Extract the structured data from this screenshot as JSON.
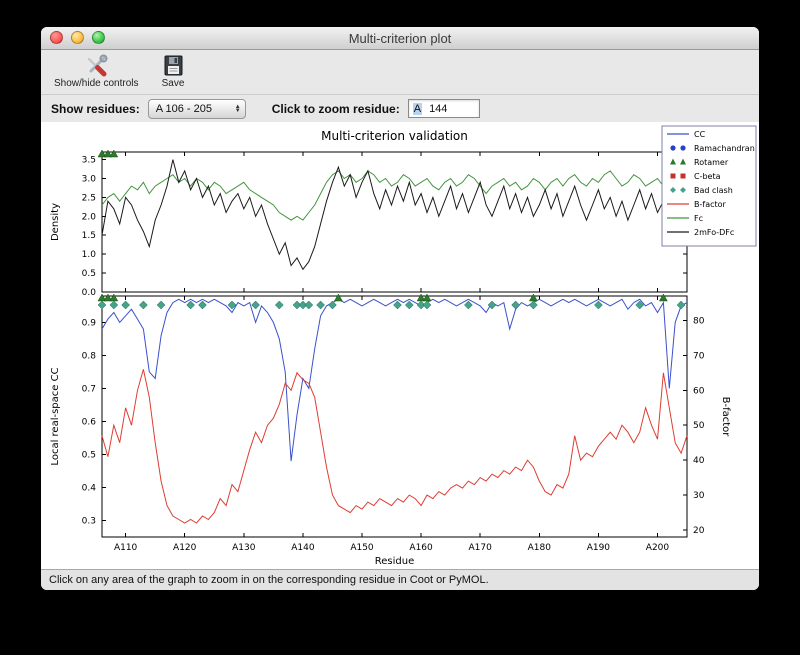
{
  "window": {
    "title": "Multi-criterion plot"
  },
  "toolbar": {
    "show_hide": "Show/hide controls",
    "save": "Save"
  },
  "controls": {
    "show_residues_label": "Show residues:",
    "residue_range": "A 106 - 205",
    "zoom_label": "Click to zoom residue:",
    "zoom_chain": "A",
    "zoom_number": "144"
  },
  "status": "Click on any area of the graph to zoom in on the corresponding residue in Coot or PyMOL.",
  "chart_data": {
    "type": "line",
    "title": "Multi-criterion validation",
    "xlabel": "Residue",
    "x_range": [
      106,
      205
    ],
    "x_ticks": [
      "A110",
      "A120",
      "A130",
      "A140",
      "A150",
      "A160",
      "A170",
      "A180",
      "A190",
      "A200"
    ],
    "top": {
      "ylabel": "Density",
      "ylim": [
        0.0,
        3.7
      ],
      "yticks": [
        0.0,
        0.5,
        1.0,
        1.5,
        2.0,
        2.5,
        3.0,
        3.5
      ]
    },
    "bottom": {
      "ylabel_left": "Local real-space CC",
      "ylim_left": [
        0.25,
        0.98
      ],
      "yticks_left": [
        0.3,
        0.4,
        0.5,
        0.6,
        0.7,
        0.8,
        0.9
      ],
      "ylabel_right": "B-factor",
      "ylim_right": [
        18,
        87
      ],
      "yticks_right": [
        20,
        30,
        40,
        50,
        60,
        70,
        80
      ]
    },
    "axis_label_colors": {
      "left": "#3b50cc",
      "right": "#dd3d33"
    },
    "legend": [
      {
        "label": "CC",
        "type": "line",
        "color": "#3b50cc"
      },
      {
        "label": "Ramachandran",
        "type": "circles",
        "color": "#2742c8"
      },
      {
        "label": "Rotamer",
        "type": "triangles",
        "color": "#2c7a2c"
      },
      {
        "label": "C-beta",
        "type": "squares",
        "color": "#c43030"
      },
      {
        "label": "Bad clash",
        "type": "diamonds",
        "color": "#46a28b"
      },
      {
        "label": "B-factor",
        "type": "line",
        "color": "#dd3d33"
      },
      {
        "label": "Fc",
        "type": "line",
        "color": "#44953f"
      },
      {
        "label": "2mFo-DFc",
        "type": "line",
        "color": "#1a1a1a"
      }
    ],
    "series": [
      {
        "id": "fc",
        "name": "Fc",
        "axis": "top",
        "color": "#44953f",
        "values": [
          2.3,
          2.5,
          2.6,
          2.4,
          2.6,
          2.8,
          2.7,
          2.9,
          2.6,
          2.8,
          2.9,
          3.0,
          3.1,
          2.9,
          3.0,
          2.8,
          3.0,
          2.9,
          2.7,
          2.9,
          2.8,
          2.6,
          2.7,
          2.8,
          2.9,
          2.7,
          2.6,
          2.5,
          2.4,
          2.3,
          2.1,
          2.0,
          1.9,
          2.0,
          1.9,
          2.1,
          2.3,
          2.6,
          2.9,
          3.1,
          3.2,
          3.0,
          3.1,
          2.9,
          3.0,
          3.2,
          3.1,
          2.9,
          3.0,
          2.8,
          2.9,
          3.1,
          3.0,
          2.8,
          2.9,
          3.0,
          2.8,
          2.7,
          2.9,
          3.0,
          2.8,
          2.9,
          3.1,
          3.0,
          2.8,
          2.6,
          2.8,
          2.9,
          3.0,
          2.8,
          2.9,
          2.7,
          2.8,
          3.0,
          2.9,
          2.7,
          2.9,
          3.0,
          2.8,
          3.0,
          3.1,
          2.9,
          2.8,
          3.0,
          2.9,
          3.1,
          3.2,
          3.0,
          2.8,
          2.9,
          3.1,
          3.0,
          2.8,
          2.9,
          3.0,
          2.8,
          2.6,
          2.9,
          3.1,
          2.8
        ]
      },
      {
        "id": "2mfo-dfc",
        "name": "2mFo-DFc",
        "axis": "top",
        "color": "#1a1a1a",
        "values": [
          1.5,
          2.4,
          2.2,
          1.8,
          2.5,
          2.3,
          1.9,
          1.6,
          1.2,
          1.9,
          2.3,
          2.8,
          3.5,
          2.9,
          3.2,
          2.7,
          3.0,
          2.5,
          2.8,
          2.3,
          2.6,
          2.1,
          2.4,
          2.6,
          2.2,
          2.5,
          2.0,
          2.3,
          1.8,
          1.4,
          1.0,
          1.3,
          0.7,
          0.9,
          0.6,
          0.8,
          1.2,
          1.8,
          2.4,
          2.9,
          3.3,
          2.8,
          3.1,
          2.5,
          2.9,
          3.2,
          2.6,
          2.2,
          2.7,
          2.3,
          2.8,
          2.4,
          2.9,
          2.3,
          2.6,
          2.1,
          2.5,
          2.0,
          2.4,
          2.8,
          2.2,
          2.6,
          2.1,
          2.5,
          2.9,
          2.3,
          2.0,
          2.4,
          2.8,
          2.2,
          2.6,
          2.1,
          2.5,
          2.0,
          2.3,
          2.7,
          2.2,
          2.6,
          2.0,
          2.4,
          2.8,
          2.3,
          1.9,
          2.3,
          2.7,
          2.2,
          2.5,
          2.0,
          2.4,
          1.9,
          2.3,
          2.7,
          2.2,
          2.6,
          2.1,
          2.4,
          1.9,
          2.3,
          2.7,
          2.4
        ]
      },
      {
        "id": "cc",
        "name": "CC",
        "axis": "bottom-left",
        "color": "#3b50cc",
        "values": [
          0.88,
          0.91,
          0.93,
          0.9,
          0.92,
          0.94,
          0.91,
          0.88,
          0.75,
          0.73,
          0.86,
          0.93,
          0.96,
          0.97,
          0.96,
          0.97,
          0.96,
          0.97,
          0.96,
          0.97,
          0.96,
          0.95,
          0.93,
          0.96,
          0.95,
          0.96,
          0.9,
          0.95,
          0.93,
          0.9,
          0.85,
          0.75,
          0.48,
          0.62,
          0.73,
          0.7,
          0.82,
          0.92,
          0.95,
          0.96,
          0.97,
          0.96,
          0.97,
          0.96,
          0.95,
          0.96,
          0.97,
          0.96,
          0.95,
          0.96,
          0.97,
          0.96,
          0.97,
          0.96,
          0.95,
          0.96,
          0.97,
          0.96,
          0.97,
          0.96,
          0.95,
          0.96,
          0.97,
          0.96,
          0.95,
          0.93,
          0.96,
          0.95,
          0.96,
          0.88,
          0.94,
          0.96,
          0.95,
          0.96,
          0.97,
          0.96,
          0.95,
          0.96,
          0.97,
          0.96,
          0.97,
          0.96,
          0.95,
          0.96,
          0.97,
          0.96,
          0.95,
          0.96,
          0.97,
          0.94,
          0.96,
          0.97,
          0.95,
          0.96,
          0.93,
          0.96,
          0.7,
          0.9,
          0.95,
          0.96
        ]
      },
      {
        "id": "b-factor",
        "name": "B-factor",
        "axis": "bottom-right",
        "color": "#dd3d33",
        "values": [
          47,
          41,
          50,
          45,
          55,
          50,
          60,
          66,
          58,
          45,
          34,
          27,
          24,
          23,
          22,
          23,
          22,
          24,
          23,
          25,
          29,
          27,
          33,
          31,
          37,
          43,
          48,
          45,
          50,
          52,
          56,
          62,
          60,
          65,
          63,
          62,
          58,
          48,
          38,
          30,
          27,
          26,
          25,
          27,
          26,
          28,
          27,
          29,
          28,
          27,
          29,
          28,
          30,
          29,
          27,
          30,
          29,
          31,
          30,
          32,
          33,
          32,
          34,
          33,
          35,
          34,
          36,
          35,
          37,
          36,
          38,
          37,
          40,
          38,
          34,
          31,
          30,
          33,
          32,
          36,
          47,
          40,
          42,
          41,
          44,
          46,
          48,
          46,
          50,
          48,
          45,
          48,
          55,
          50,
          46,
          65,
          55,
          45,
          42,
          47
        ]
      }
    ],
    "markers": [
      {
        "name": "Rotamer",
        "shape": "triangle",
        "color": "#2c7a2c",
        "residues": [
          106,
          107,
          108,
          146,
          160,
          161,
          179,
          201
        ],
        "top_edge_residues": [
          106,
          107,
          108
        ]
      },
      {
        "name": "Bad clash",
        "shape": "diamond",
        "color": "#46a28b",
        "residues": [
          106,
          108,
          110,
          113,
          116,
          121,
          123,
          128,
          132,
          136,
          139,
          140,
          141,
          143,
          145,
          156,
          158,
          160,
          161,
          168,
          172,
          176,
          179,
          190,
          197,
          204
        ]
      }
    ]
  }
}
